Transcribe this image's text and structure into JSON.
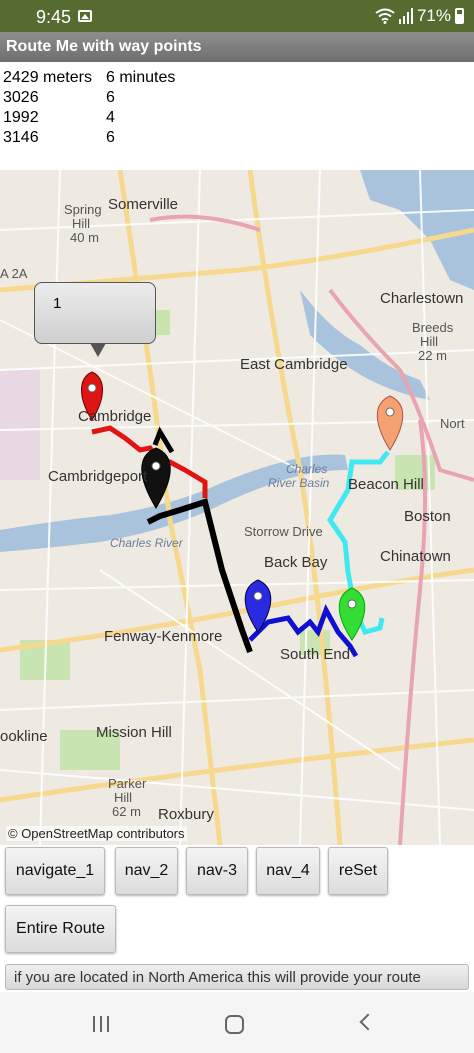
{
  "status": {
    "time": "9:45",
    "battery": "71%"
  },
  "app": {
    "title": "Route Me with way points"
  },
  "route_info": {
    "rows": [
      {
        "distance": "2429 meters",
        "time": "6 minutes"
      },
      {
        "distance": "3026",
        "time": "6"
      },
      {
        "distance": "1992",
        "time": "4"
      },
      {
        "distance": "3146",
        "time": "6"
      }
    ]
  },
  "map": {
    "labels": {
      "somerville": "Somerville",
      "spring_hill": "Spring",
      "spring_hill2": "Hill",
      "spring_hill_elev": "40 m",
      "charlestown": "Charlestown",
      "breeds_hill": "Breeds",
      "breeds_hill2": "Hill",
      "breeds_elev": "22 m",
      "east_cambridge": "East Cambridge",
      "cambridge": "Cambridge",
      "cambridgeport": "Cambridgeport",
      "charles_river_basin": "Charles",
      "charles_river_basin2": "River Basin",
      "beacon_hill": "Beacon Hill",
      "boston": "Boston",
      "chinatown": "Chinatown",
      "back_bay": "Back Bay",
      "storrow": "Storrow Drive",
      "charles_river": "Charles River",
      "fenway_kenmore": "Fenway-Kenmore",
      "south_end": "South End",
      "mission_hill": "Mission Hill",
      "parker_hill": "Parker",
      "parker_hill2": "Hill",
      "parker_elev": "62 m",
      "roxbury": "Roxbury",
      "brookline": "ookline",
      "north": "Nort",
      "route_2a": "A 2A"
    },
    "attribution": "© OpenStreetMap contributors",
    "callout_text": "1",
    "markers": [
      {
        "name": "red-marker",
        "color": "#e11414"
      },
      {
        "name": "black-marker",
        "color": "#111111"
      },
      {
        "name": "blue-marker",
        "color": "#2a2ae0"
      },
      {
        "name": "green-marker",
        "color": "#33dd33"
      },
      {
        "name": "orange-marker",
        "color": "#f4a070"
      }
    ],
    "route_colors": {
      "red": "#e11414",
      "black": "#000000",
      "blue": "#1010d0",
      "cyan": "#40e8f0"
    }
  },
  "buttons": {
    "navigate_1": "navigate_1",
    "nav_2": "nav_2",
    "nav_3": "nav-3",
    "nav_4": "nav_4",
    "reset": "reSet",
    "entire_route": "Entire Route"
  },
  "info_strip": {
    "text": "if you are located in North America this will provide your route"
  }
}
